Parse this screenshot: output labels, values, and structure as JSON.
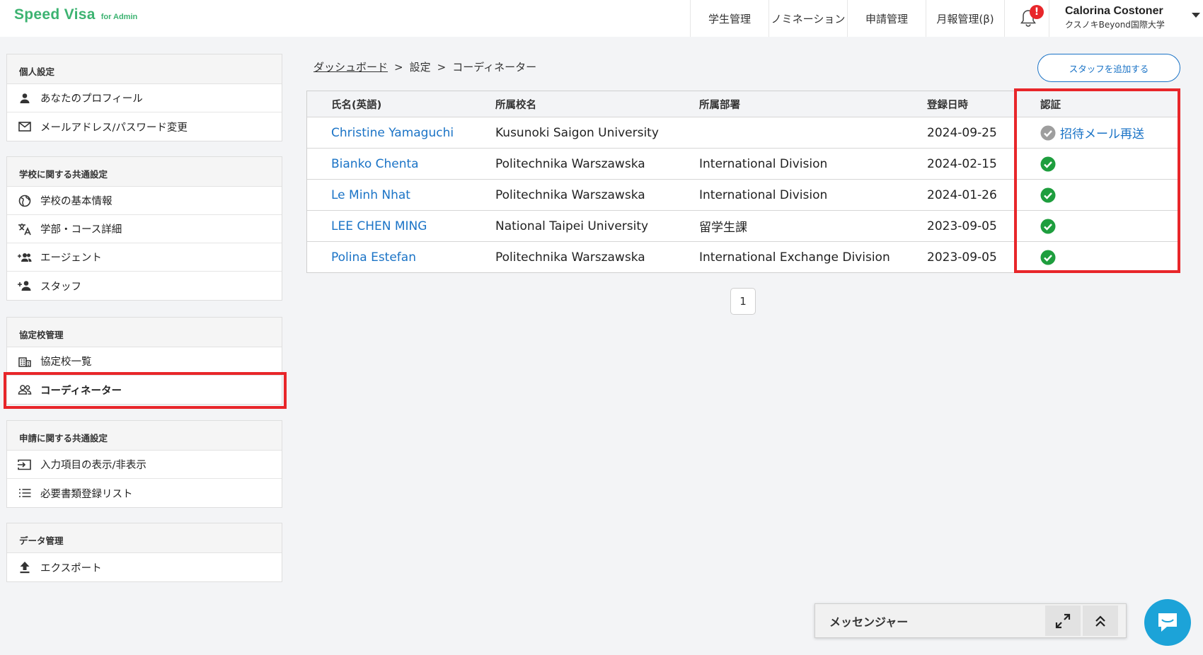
{
  "app": {
    "logo": "Speed Visa",
    "logo_sub": "for Admin"
  },
  "nav": [
    {
      "label": "学生管理"
    },
    {
      "label": "ノミネーション"
    },
    {
      "label": "申請管理"
    },
    {
      "label": "月報管理(β)"
    }
  ],
  "notifications": {
    "badge": "!",
    "icon": "bell-icon"
  },
  "user": {
    "name": "Calorina Costoner",
    "school": "クスノキBeyond国際大学"
  },
  "sidebar": {
    "personal": {
      "title": "個人設定",
      "items": [
        {
          "label": "あなたのプロフィール",
          "icon": "person-icon"
        },
        {
          "label": "メールアドレス/パスワード変更",
          "icon": "mail-icon"
        }
      ]
    },
    "school": {
      "title": "学校に関する共通設定",
      "items": [
        {
          "label": "学校の基本情報",
          "icon": "globe-icon"
        },
        {
          "label": "学部・コース詳細",
          "icon": "translate-icon"
        },
        {
          "label": "エージェント",
          "icon": "group-add-icon"
        },
        {
          "label": "スタッフ",
          "icon": "person-add-icon"
        }
      ]
    },
    "partner": {
      "title": "協定校管理",
      "items": [
        {
          "label": "協定校一覧",
          "icon": "building-icon"
        },
        {
          "label": "コーディネーター",
          "icon": "people-icon"
        }
      ]
    },
    "application": {
      "title": "申請に関する共通設定",
      "items": [
        {
          "label": "入力項目の表示/非表示",
          "icon": "input-icon"
        },
        {
          "label": "必要書類登録リスト",
          "icon": "list-icon"
        }
      ]
    },
    "data": {
      "title": "データ管理",
      "items": [
        {
          "label": "エクスポート",
          "icon": "upload-icon"
        }
      ]
    }
  },
  "breadcrumb": {
    "home": "ダッシュボード",
    "settings": "設定",
    "current": "コーディネーター",
    "sep": ">"
  },
  "actions": {
    "add_staff": "スタッフを追加する"
  },
  "table": {
    "headers": {
      "name": "氏名(英語)",
      "school": "所属校名",
      "department": "所属部署",
      "registered": "登録日時",
      "auth": "認証"
    },
    "rows": [
      {
        "name": "Christine Yamaguchi",
        "school": "Kusunoki Saigon University",
        "department": "",
        "registered": "2024-09-25",
        "auth": "pending",
        "auth_label": "招待メール再送"
      },
      {
        "name": "Bianko Chenta",
        "school": "Politechnika Warszawska",
        "department": "International Division",
        "registered": "2024-02-15",
        "auth": "verified"
      },
      {
        "name": "Le Minh Nhat",
        "school": "Politechnika Warszawska",
        "department": "International Division",
        "registered": "2024-01-26",
        "auth": "verified"
      },
      {
        "name": "LEE CHEN MING",
        "school": "National Taipei University",
        "department": "留学生課",
        "registered": "2023-09-05",
        "auth": "verified"
      },
      {
        "name": "Polina Estefan",
        "school": "Politechnika Warszawska",
        "department": "International Exchange Division",
        "registered": "2023-09-05",
        "auth": "verified"
      }
    ]
  },
  "pagination": {
    "current": "1"
  },
  "messenger": {
    "title": "メッセンジャー"
  },
  "colors": {
    "brand": "#3cb371",
    "link": "#1a73c6",
    "highlight": "#e8262a",
    "verified": "#1e9e3e",
    "pending": "#9e9e9e",
    "chat": "#1ca3d8"
  }
}
